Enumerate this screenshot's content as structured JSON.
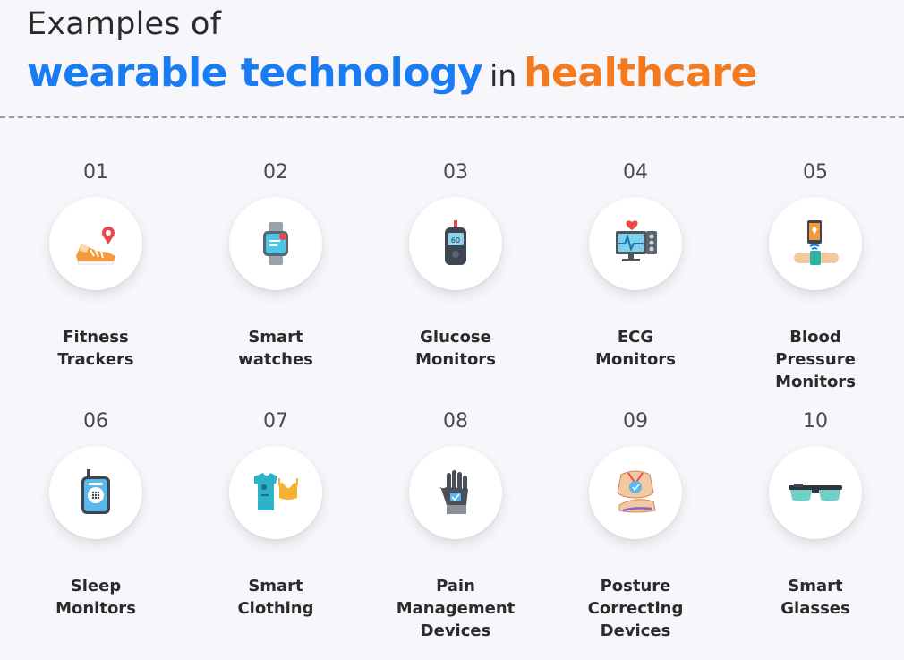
{
  "title": {
    "line1": "Examples of",
    "highlight_blue": "wearable technology",
    "connector": "in",
    "highlight_orange": "healthcare"
  },
  "colors": {
    "blue": "#1a7cf2",
    "orange": "#f47a1f",
    "text": "#2b2b2b",
    "background": "#f7f7fb"
  },
  "items": [
    {
      "number": "01",
      "label_lines": [
        "Fitness",
        "Trackers"
      ],
      "icon": "running-shoe-location-icon"
    },
    {
      "number": "02",
      "label_lines": [
        "Smart",
        "watches"
      ],
      "icon": "smartwatch-icon"
    },
    {
      "number": "03",
      "label_lines": [
        "Glucose",
        "Monitors"
      ],
      "icon": "glucose-meter-icon"
    },
    {
      "number": "04",
      "label_lines": [
        "ECG",
        "Monitors"
      ],
      "icon": "ecg-monitor-icon"
    },
    {
      "number": "05",
      "label_lines": [
        "Blood",
        "Pressure",
        "Monitors"
      ],
      "icon": "phone-wristband-icon"
    },
    {
      "number": "06",
      "label_lines": [
        "Sleep",
        "Monitors"
      ],
      "icon": "sleep-monitor-device-icon"
    },
    {
      "number": "07",
      "label_lines": [
        "Smart",
        "Clothing"
      ],
      "icon": "smart-shirt-icon"
    },
    {
      "number": "08",
      "label_lines": [
        "Pain",
        "Management",
        "Devices"
      ],
      "icon": "smart-glove-icon"
    },
    {
      "number": "09",
      "label_lines": [
        "Posture",
        "Correcting",
        "Devices"
      ],
      "icon": "posture-body-icon"
    },
    {
      "number": "10",
      "label_lines": [
        "Smart",
        "Glasses"
      ],
      "icon": "smart-glasses-icon"
    }
  ]
}
